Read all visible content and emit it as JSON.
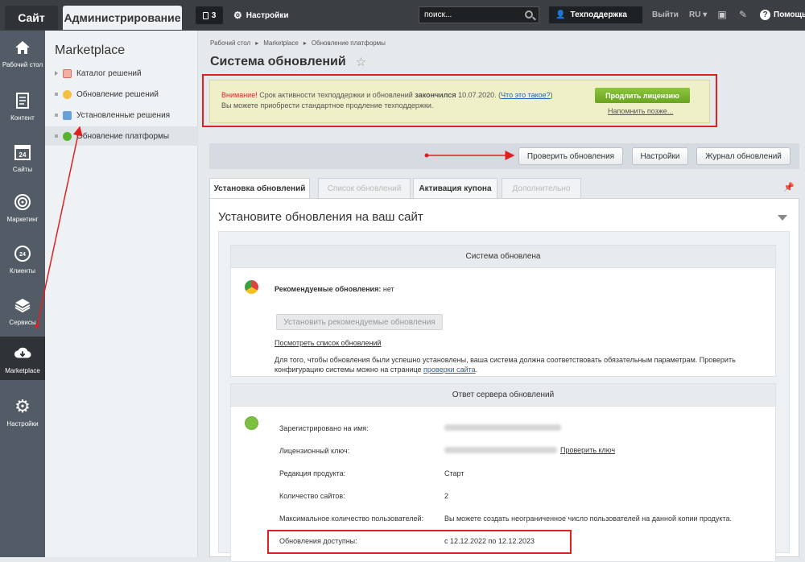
{
  "topbar": {
    "site_tab": "Сайт",
    "admin_tab": "Администрирование",
    "notifications_count": "3",
    "settings_label": "Настройки",
    "search_value": "поиск...",
    "user_name": "Техподдержка",
    "logout_label": "Выйти",
    "lang_label": "RU",
    "help_label": "Помощь"
  },
  "leftnav": {
    "items": [
      {
        "label": "Рабочий стол",
        "icon": "home-icon"
      },
      {
        "label": "Контент",
        "icon": "document-icon"
      },
      {
        "label": "Сайты",
        "icon": "calendar-icon"
      },
      {
        "label": "Маркетинг",
        "icon": "target-icon"
      },
      {
        "label": "Клиенты",
        "icon": "clients-icon"
      },
      {
        "label": "Сервисы",
        "icon": "layers-icon"
      },
      {
        "label": "Marketplace",
        "icon": "cloud-download-icon"
      },
      {
        "label": "Настройки",
        "icon": "gear-icon"
      }
    ]
  },
  "sidebar": {
    "title": "Marketplace",
    "items": [
      {
        "label": "Каталог решений"
      },
      {
        "label": "Обновление решений"
      },
      {
        "label": "Установленные решения"
      },
      {
        "label": "Обновление платформы"
      }
    ]
  },
  "main": {
    "breadcrumbs": [
      "Рабочий стол",
      "Marketplace",
      "Обновление платформы"
    ],
    "title": "Система обновлений",
    "warning": {
      "attention": "Внимание!",
      "text1": " Срок активности техподдержки и обновлений ",
      "expired": "закончился",
      "date": " 10.07.2020. (",
      "what_link": "Что это такое?",
      "close_paren": ")",
      "line2": "Вы можете приобрести стандартное продление техподдержки.",
      "renew_button": "Продлить лицензию",
      "remind_link": "Напомнить позже..."
    },
    "toolbar": {
      "check_button": "Проверить обновления",
      "settings_button": "Настройки",
      "log_button": "Журнал обновлений"
    },
    "tabs": [
      {
        "label": "Установка обновлений"
      },
      {
        "label": "Список обновлений"
      },
      {
        "label": "Активация купона"
      },
      {
        "label": "Дополнительно"
      }
    ],
    "panel_title": "Установите обновления на ваш сайт",
    "system_box": {
      "header": "Система обновлена",
      "recommended_label": "Рекомендуемые обновления:",
      "recommended_value": "нет",
      "install_button": "Установить рекомендуемые обновления",
      "view_list_link": "Посмотреть список обновлений",
      "desc": "Для того, чтобы обновления были успешно установлены, ваша система должна соответствовать обязательным параметрам. Проверить конфигурацию системы можно на странице ",
      "check_site_link": "проверки сайта",
      "desc_end": "."
    },
    "server_box": {
      "header": "Ответ сервера обновлений",
      "registered_label": "Зарегистрировано на имя:",
      "license_label": "Лицензионный ключ:",
      "check_key_link": "Проверить ключ",
      "edition_label": "Редакция продукта:",
      "edition_value": "Старт",
      "sites_label": "Количество сайтов:",
      "sites_value": "2",
      "max_users_label": "Максимальное количество пользователей:",
      "max_users_value": "Вы можете создать неограниченное число пользователей на данной копии продукта.",
      "updates_label": "Обновления доступны:",
      "updates_value": "с 12.12.2022 по 12.12.2023"
    }
  }
}
